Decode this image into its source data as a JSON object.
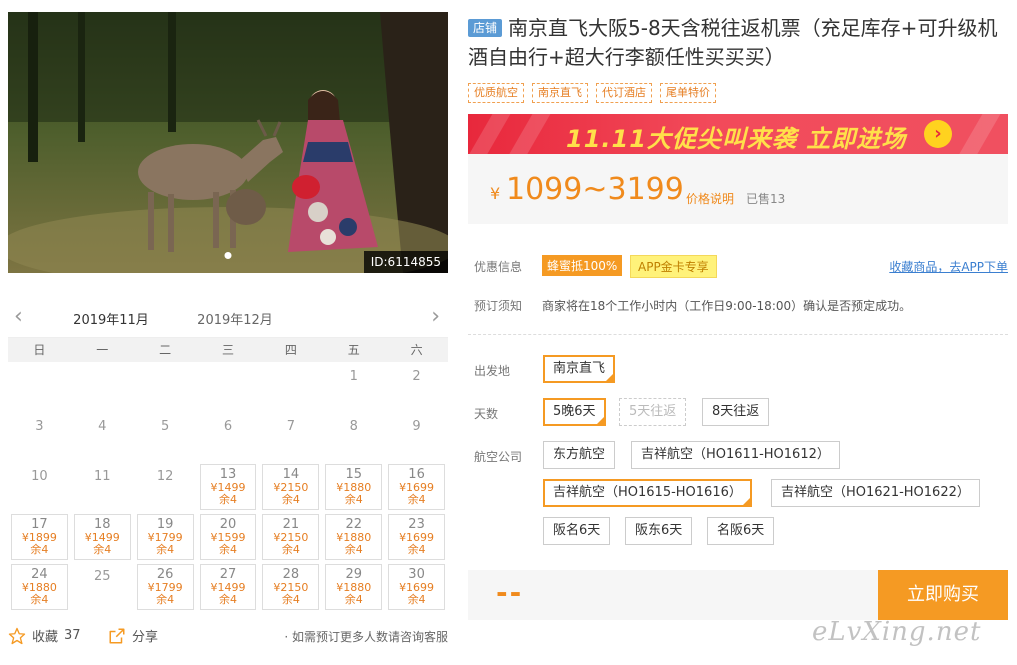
{
  "hero": {
    "image_description": "woman in kimono feeding a deer in a park",
    "id_label": "ID:6114855"
  },
  "calendar": {
    "months": [
      "2019年11月",
      "2019年12月"
    ],
    "active_month": 0,
    "weekdays": [
      "日",
      "一",
      "二",
      "三",
      "四",
      "五",
      "六"
    ],
    "leading_blanks": 5,
    "days": [
      {
        "d": "1"
      },
      {
        "d": "2"
      },
      {
        "d": "3"
      },
      {
        "d": "4"
      },
      {
        "d": "5"
      },
      {
        "d": "6"
      },
      {
        "d": "7"
      },
      {
        "d": "8"
      },
      {
        "d": "9"
      },
      {
        "d": "10"
      },
      {
        "d": "11"
      },
      {
        "d": "12"
      },
      {
        "d": "13",
        "p": "¥1499",
        "s": "余4"
      },
      {
        "d": "14",
        "p": "¥2150",
        "s": "余4"
      },
      {
        "d": "15",
        "p": "¥1880",
        "s": "余4"
      },
      {
        "d": "16",
        "p": "¥1699",
        "s": "余4"
      },
      {
        "d": "17",
        "p": "¥1899",
        "s": "余4"
      },
      {
        "d": "18",
        "p": "¥1499",
        "s": "余4"
      },
      {
        "d": "19",
        "p": "¥1799",
        "s": "余4"
      },
      {
        "d": "20",
        "p": "¥1599",
        "s": "余4"
      },
      {
        "d": "21",
        "p": "¥2150",
        "s": "余4"
      },
      {
        "d": "22",
        "p": "¥1880",
        "s": "余4"
      },
      {
        "d": "23",
        "p": "¥1699",
        "s": "余4"
      },
      {
        "d": "24",
        "p": "¥1880",
        "s": "余4"
      },
      {
        "d": "25"
      },
      {
        "d": "26",
        "p": "¥1799",
        "s": "余4"
      },
      {
        "d": "27",
        "p": "¥1499",
        "s": "余4"
      },
      {
        "d": "28",
        "p": "¥2150",
        "s": "余4"
      },
      {
        "d": "29",
        "p": "¥1880",
        "s": "余4"
      },
      {
        "d": "30",
        "p": "¥1699",
        "s": "余4"
      }
    ]
  },
  "bottom": {
    "fav_label": "收藏",
    "fav_count": "37",
    "share_label": "分享",
    "consult": "· 如需预订更多人数请咨询客服"
  },
  "product": {
    "shop_badge": "店铺",
    "title": "南京直飞大阪5-8天含税往返机票（充足库存+可升级机酒自由行+超大行李额任性买买买）",
    "tags": [
      "优质航空",
      "南京直飞",
      "代订酒店",
      "尾单特价"
    ],
    "banner_text": "11.11大促尖叫来袭  立即进场",
    "currency": "¥",
    "price_range": "1099~3199",
    "price_note": "价格说明",
    "sold": "已售13"
  },
  "promo": {
    "label": "优惠信息",
    "badge_1": "蜂蜜抵100%",
    "badge_2": "APP金卡专享",
    "link": "收藏商品，去APP下单"
  },
  "notice": {
    "label": "预订须知",
    "text": "商家将在18个工作小时内（工作日9:00-18:00）确认是否预定成功。"
  },
  "options": {
    "depart_label": "出发地",
    "depart": [
      "南京直飞"
    ],
    "days_label": "天数",
    "days": [
      "5晚6天",
      "5天往返",
      "8天往返"
    ],
    "airline_label": "航空公司",
    "airlines": [
      "东方航空",
      "吉祥航空（HO1611-HO1612）",
      "吉祥航空（HO1615-HO1616）",
      "吉祥航空（HO1621-HO1622）",
      "阪名6天",
      "阪东6天",
      "名阪6天"
    ]
  },
  "buy": {
    "total": "--",
    "button": "立即购买"
  },
  "watermark": "eLvXing.net",
  "colors": {
    "accent": "#f59a23",
    "price": "#f08a1c",
    "banner": "#e8283c",
    "link": "#3b7fd0"
  }
}
